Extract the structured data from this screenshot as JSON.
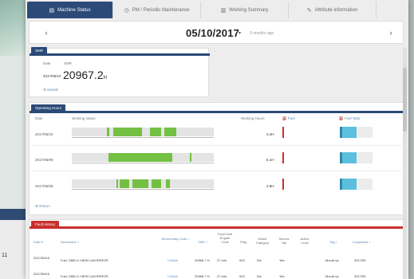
{
  "background": {
    "number_text": "11"
  },
  "tabs": [
    {
      "label": "Machine Status",
      "icon": "document-icon",
      "active": true
    },
    {
      "label": "PM / Periodic Maintenance",
      "icon": "clock-icon",
      "active": false
    },
    {
      "label": "Working Summary",
      "icon": "chart-icon",
      "active": false
    },
    {
      "label": "Attribute information",
      "icon": "tag-icon",
      "active": false
    }
  ],
  "datebar": {
    "prev_label": "‹",
    "next_label": "›",
    "date": "05/10/2017",
    "caret": "▾",
    "ago": "3 months ago"
  },
  "smr_panel": {
    "tag": "SMR",
    "date_label": "Date",
    "smr_label": "SMR",
    "date_value": "2017/05/10",
    "smr_value": "20967.2",
    "smr_unit": "H",
    "link": "⚙ Details"
  },
  "operating_hours": {
    "tag": "Operating Hours",
    "headers": {
      "date": "Date",
      "status": "Working status",
      "hours": "Working Hours",
      "fuel": "⛽ Fuel",
      "fuel_tank": "⛽ Fuel Tank"
    },
    "rows": [
      {
        "date": "2017/05/10",
        "hours": "3.4H",
        "fuel_level": 0.55
      },
      {
        "date": "2017/05/09",
        "hours": "5.1H",
        "fuel_level": 0.55
      },
      {
        "date": "2017/05/08",
        "hours": "3.8H",
        "fuel_level": 0.55
      }
    ],
    "link": "⚙ Return"
  },
  "fault_panel": {
    "tag": "Fault History",
    "headers": [
      "Date ▾",
      "Description ↕",
      "Abnormality Code ↕",
      "SMR ↕",
      "Fault Hold Engine Code",
      "Flag",
      "Model Category",
      "Service Tab",
      "Active Level",
      "Tag ↕",
      "Completed ↕"
    ],
    "rows": [
      {
        "date": "2017/05/10",
        "desc": "Fuel, DMD-0: NEW LUM ERROR",
        "code": "C4AAA",
        "smr": "20966.7 H",
        "hold": "27 min",
        "flag": "003",
        "model": "Wx",
        "service": "Yes",
        "tag": "Mount up",
        "completed": "2017/05"
      },
      {
        "date": "2017/05/10",
        "desc": "Fuel, DMD-0: NEW LUM ERROR",
        "code": "C4AAA",
        "smr": "20966.7 H",
        "hold": "27 min",
        "flag": "003",
        "model": "Wx",
        "service": "Yes",
        "tag": "Mount up",
        "completed": "2017/05"
      }
    ]
  }
}
